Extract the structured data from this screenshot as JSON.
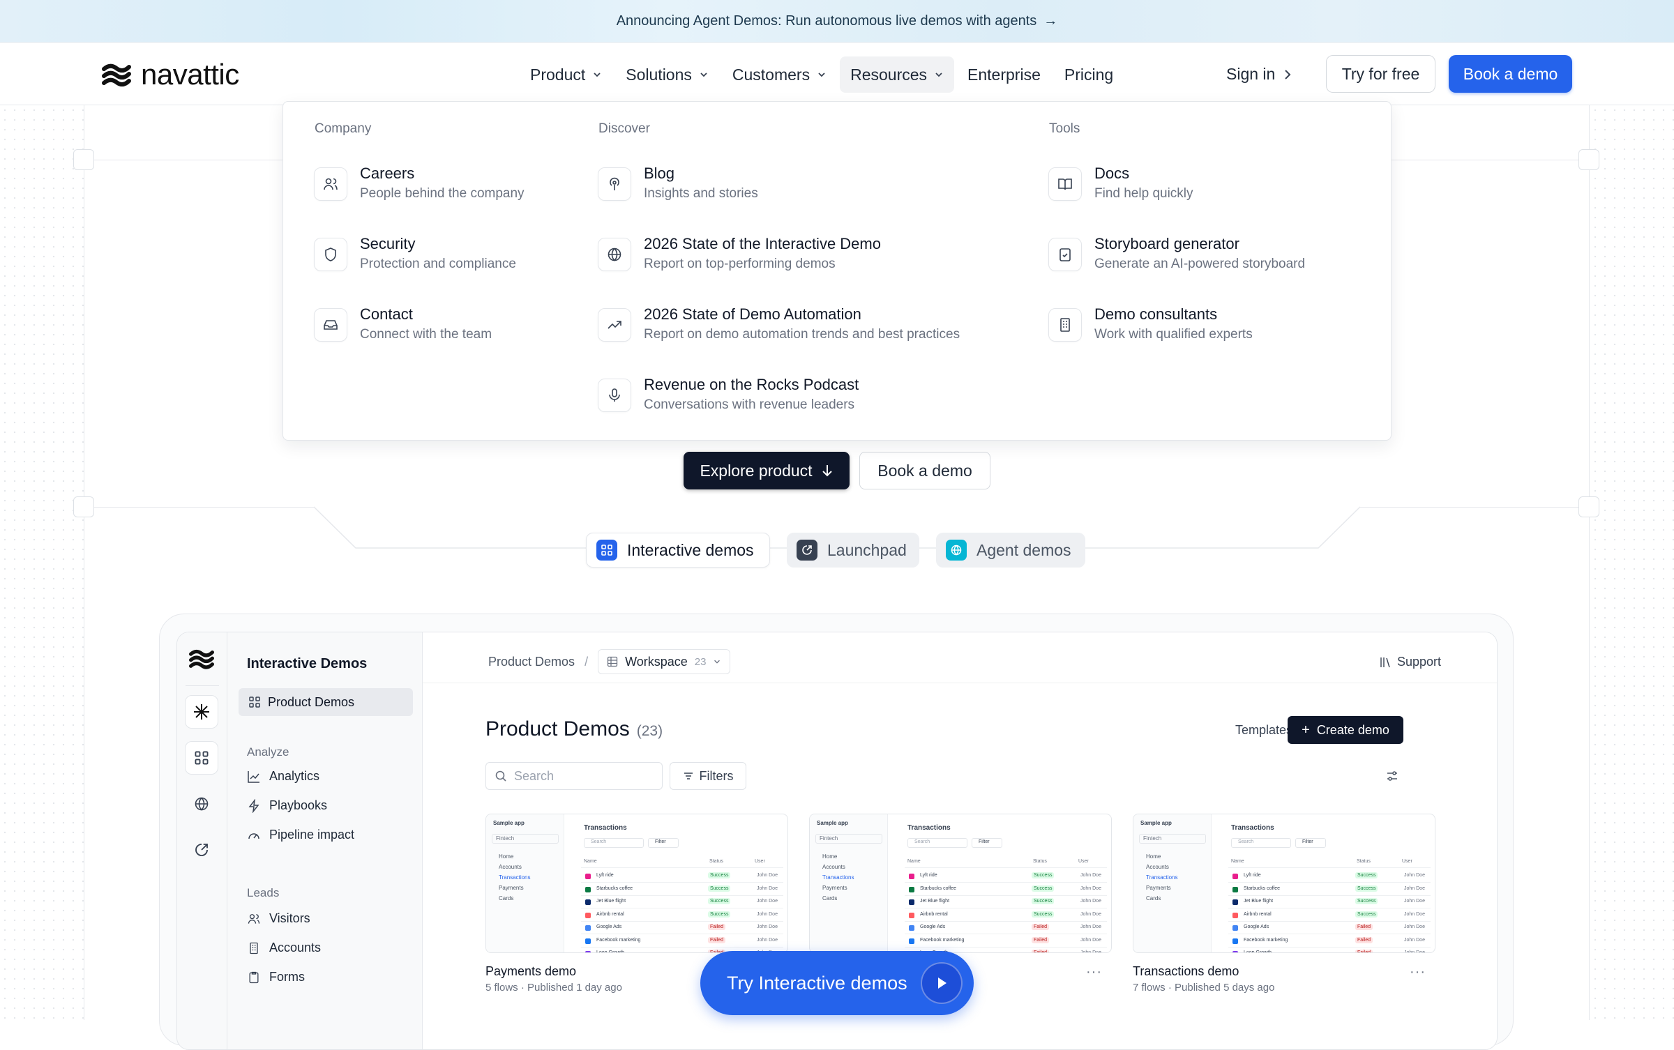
{
  "banner": {
    "text": "Announcing Agent Demos: Run autonomous live demos with agents",
    "arrow": "→"
  },
  "brand": {
    "name": "navattic",
    "accent": "#2563eb"
  },
  "nav": {
    "items": [
      {
        "label": "Product",
        "has_menu": true
      },
      {
        "label": "Solutions",
        "has_menu": true
      },
      {
        "label": "Customers",
        "has_menu": true
      },
      {
        "label": "Resources",
        "has_menu": true,
        "active": true
      },
      {
        "label": "Enterprise",
        "has_menu": false
      },
      {
        "label": "Pricing",
        "has_menu": false
      }
    ],
    "signin": "Sign in",
    "try_free": "Try for free",
    "book_demo": "Book a demo"
  },
  "dropdown": {
    "company": {
      "header": "Company",
      "items": [
        {
          "title": "Careers",
          "sub": "People behind the company",
          "icon": "users-icon"
        },
        {
          "title": "Security",
          "sub": "Protection and compliance",
          "icon": "shield-icon"
        },
        {
          "title": "Contact",
          "sub": "Connect with the team",
          "icon": "inbox-icon"
        }
      ]
    },
    "discover": {
      "header": "Discover",
      "items": [
        {
          "title": "Blog",
          "sub": "Insights and stories",
          "icon": "podcast-icon"
        },
        {
          "title": "2026 State of the Interactive Demo",
          "sub": "Report on top-performing demos",
          "icon": "globe-icon"
        },
        {
          "title": "2026 State of Demo Automation",
          "sub": "Report on demo automation trends and best practices",
          "icon": "trend-icon"
        },
        {
          "title": "Revenue on the Rocks Podcast",
          "sub": "Conversations with revenue leaders",
          "icon": "mic-icon"
        }
      ]
    },
    "tools": {
      "header": "Tools",
      "items": [
        {
          "title": "Docs",
          "sub": "Find help quickly",
          "icon": "book-icon"
        },
        {
          "title": "Storyboard generator",
          "sub": "Generate an AI-powered storyboard",
          "icon": "clipboard-icon"
        },
        {
          "title": "Demo consultants",
          "sub": "Work with qualified experts",
          "icon": "building-icon"
        }
      ]
    }
  },
  "hero": {
    "explore": "Explore product",
    "book_demo": "Book a demo"
  },
  "tabs": [
    {
      "label": "Interactive demos",
      "color": "#2563eb"
    },
    {
      "label": "Launchpad",
      "color": "#374151"
    },
    {
      "label": "Agent demos",
      "color": "#06b6d4"
    }
  ],
  "app": {
    "sidebar": {
      "title": "Interactive Demos",
      "selected": "Product Demos",
      "analyze_header": "Analyze",
      "analyze": [
        "Analytics",
        "Playbooks",
        "Pipeline impact"
      ],
      "leads_header": "Leads",
      "leads": [
        "Visitors",
        "Accounts",
        "Forms"
      ]
    },
    "crumbs": {
      "root": "Product Demos",
      "sep": "/",
      "workspace": "Workspace",
      "workspace_count": "23"
    },
    "support": "Support",
    "title": "Product Demos",
    "count": "(23)",
    "templates": "Templates",
    "create": "Create demo",
    "search_placeholder": "Search",
    "filters": "Filters",
    "cards": [
      {
        "title": "Payments demo",
        "meta": "5 flows · Published 1 day ago"
      },
      {
        "title": "",
        "meta": ""
      },
      {
        "title": "Transactions demo",
        "meta": "7 flows · Published 5 days ago"
      }
    ],
    "mini": {
      "app": "Sample app",
      "org": "Fintech",
      "nav": [
        "Home",
        "Accounts",
        "Transactions",
        "Payments",
        "Cards"
      ],
      "heading": "Transactions",
      "search": "Search",
      "filter": "Filter",
      "cols": [
        "Name",
        "Status",
        "User"
      ],
      "rows": [
        {
          "name": "Lyft ride",
          "status": "Success",
          "user": "John Doe",
          "dot": "#e91e8c"
        },
        {
          "name": "Starbucks coffee",
          "status": "Success",
          "user": "John Doe",
          "dot": "#0b7a43"
        },
        {
          "name": "Jet Blue flight",
          "status": "Success",
          "user": "John Doe",
          "dot": "#0b2a6b"
        },
        {
          "name": "Airbnb rental",
          "status": "Success",
          "user": "John Doe",
          "dot": "#ff5a5f"
        },
        {
          "name": "Google Ads",
          "status": "Failed",
          "user": "John Doe",
          "dot": "#4285f4"
        },
        {
          "name": "Facebook marketing",
          "status": "Failed",
          "user": "John Doe",
          "dot": "#1877f2"
        },
        {
          "name": "Loop Growth",
          "status": "Failed",
          "user": "John Doe",
          "dot": "#7c3aed"
        }
      ]
    }
  },
  "floating_cta": "Try Interactive demos"
}
